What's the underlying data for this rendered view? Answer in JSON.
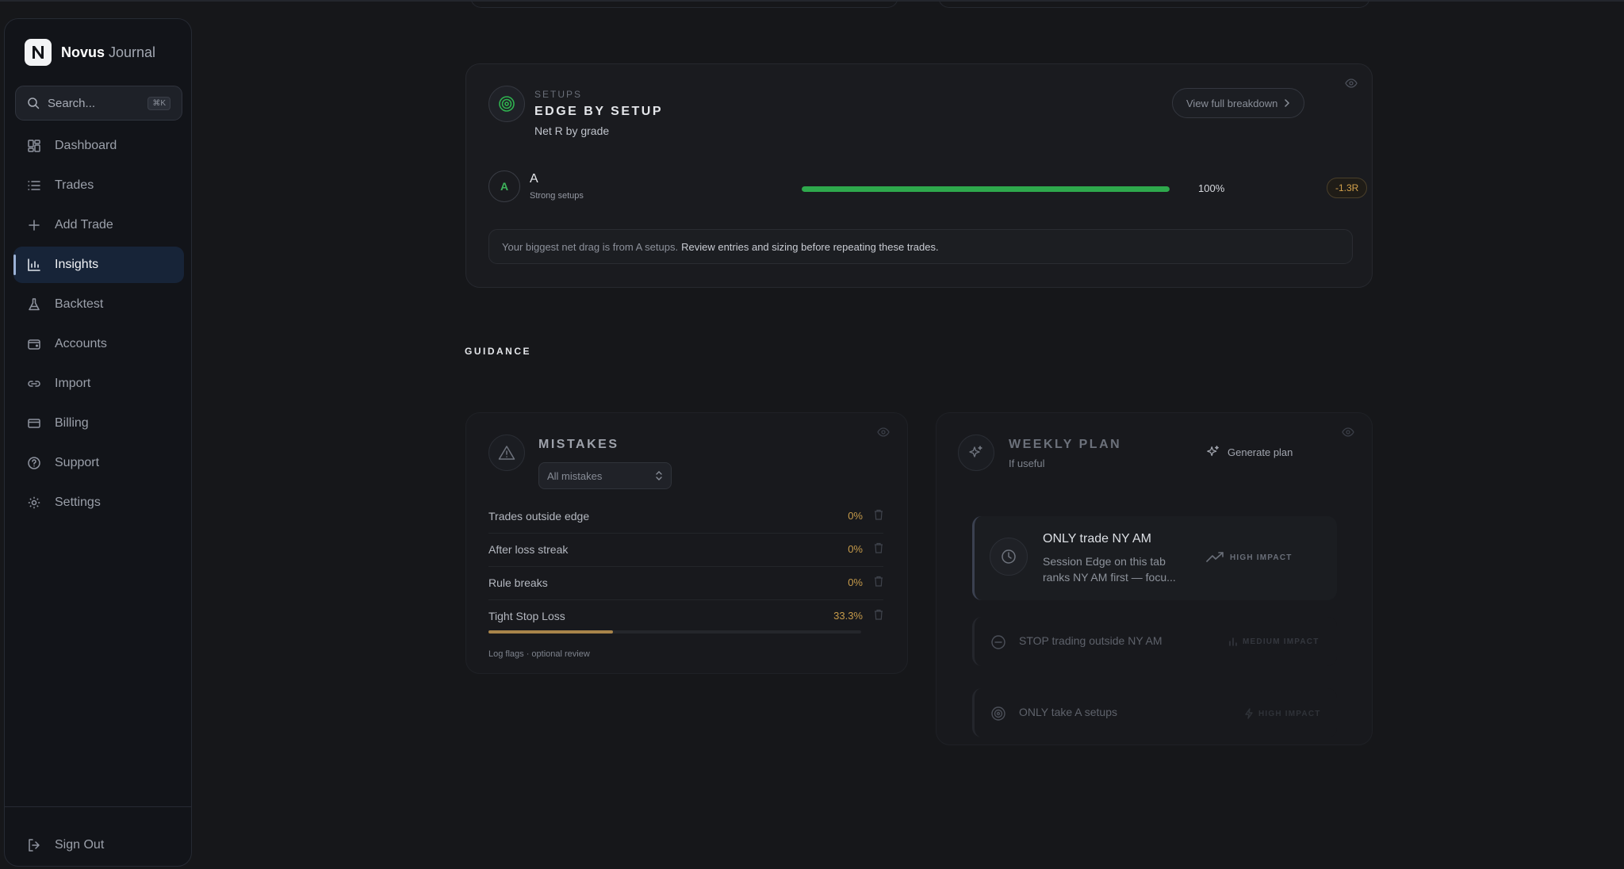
{
  "brand": {
    "name": "Novus",
    "sub": "Journal"
  },
  "search": {
    "placeholder": "Search...",
    "shortcut": "⌘K"
  },
  "nav": [
    {
      "label": "Dashboard",
      "icon": "dashboard-icon"
    },
    {
      "label": "Trades",
      "icon": "list-icon"
    },
    {
      "label": "Add Trade",
      "icon": "plus-icon"
    },
    {
      "label": "Insights",
      "icon": "bar-chart-icon",
      "active": true
    },
    {
      "label": "Backtest",
      "icon": "flask-icon"
    },
    {
      "label": "Accounts",
      "icon": "wallet-icon"
    },
    {
      "label": "Import",
      "icon": "link-icon"
    },
    {
      "label": "Billing",
      "icon": "credit-card-icon"
    },
    {
      "label": "Support",
      "icon": "help-icon"
    },
    {
      "label": "Settings",
      "icon": "gear-icon"
    }
  ],
  "signout": {
    "label": "Sign Out"
  },
  "setups": {
    "eyebrow": "SETUPS",
    "title": "EDGE BY SETUP",
    "subtitle": "Net R by grade",
    "breakdown_button": "View full breakdown",
    "grades": [
      {
        "grade": "A",
        "name": "A",
        "desc": "Strong setups",
        "share_pct": 100,
        "share_label": "100%",
        "net_r": "-1.3R"
      }
    ],
    "note_muted": "Your biggest net drag is from A setups.",
    "note_strong": "Review entries and sizing before repeating these trades."
  },
  "guidance": {
    "label": "GUIDANCE",
    "mistakes": {
      "title": "MISTAKES",
      "filter": "All mistakes",
      "rows": [
        {
          "label": "Trades outside edge",
          "pct": "0%",
          "value": 0
        },
        {
          "label": "After loss streak",
          "pct": "0%",
          "value": 0
        },
        {
          "label": "Rule breaks",
          "pct": "0%",
          "value": 0
        },
        {
          "label": "Tight Stop Loss",
          "pct": "33.3%",
          "value": 33.3
        }
      ],
      "footnote": "Log flags · optional review"
    },
    "plan": {
      "title": "WEEKLY PLAN",
      "subtitle": "If useful",
      "generate_button": "Generate plan",
      "items": [
        {
          "title": "ONLY trade NY AM",
          "desc_line1": "Session Edge on this tab",
          "desc_line2": "ranks NY AM first — focu...",
          "impact": "HIGH IMPACT"
        },
        {
          "title": "STOP trading outside NY AM",
          "impact": "MEDIUM IMPACT"
        },
        {
          "title": "ONLY take A setups",
          "impact": "HIGH IMPACT"
        }
      ]
    }
  },
  "colors": {
    "accent_green": "#2ea94c",
    "warning": "#c59a4a",
    "active_nav": "#172438"
  }
}
